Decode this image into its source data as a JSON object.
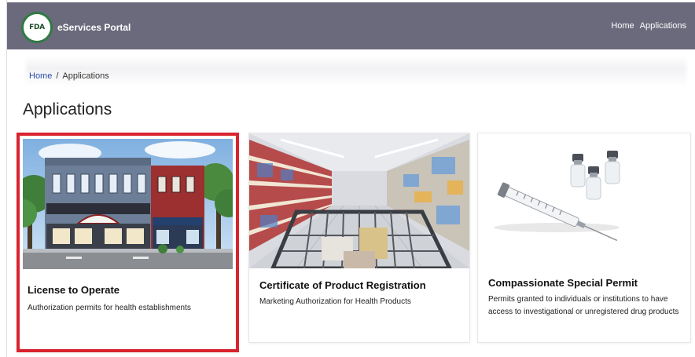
{
  "header": {
    "logo_text": "FDA",
    "brand": "eServices Portal",
    "nav": [
      "Home",
      "Applications"
    ]
  },
  "breadcrumb": {
    "home": "Home",
    "separator": "/",
    "current": "Applications"
  },
  "main": {
    "title": "Applications",
    "cards": [
      {
        "title": "License to Operate",
        "description": "Authorization permits for health establishments",
        "selected": true,
        "image": "storefront-building"
      },
      {
        "title": "Certificate of Product Registration",
        "description": "Marketing Authorization for Health Products",
        "selected": false,
        "image": "supermarket-aisle-cart"
      },
      {
        "title": "Compassionate Special Permit",
        "description": "Permits granted to individuals or institutions to have access to investigational or unregistered drug products",
        "selected": false,
        "image": "syringe-and-vials"
      }
    ]
  },
  "colors": {
    "navbar": "#6b6a7c",
    "selected_border": "#d9232e",
    "link": "#2a4fa8"
  }
}
